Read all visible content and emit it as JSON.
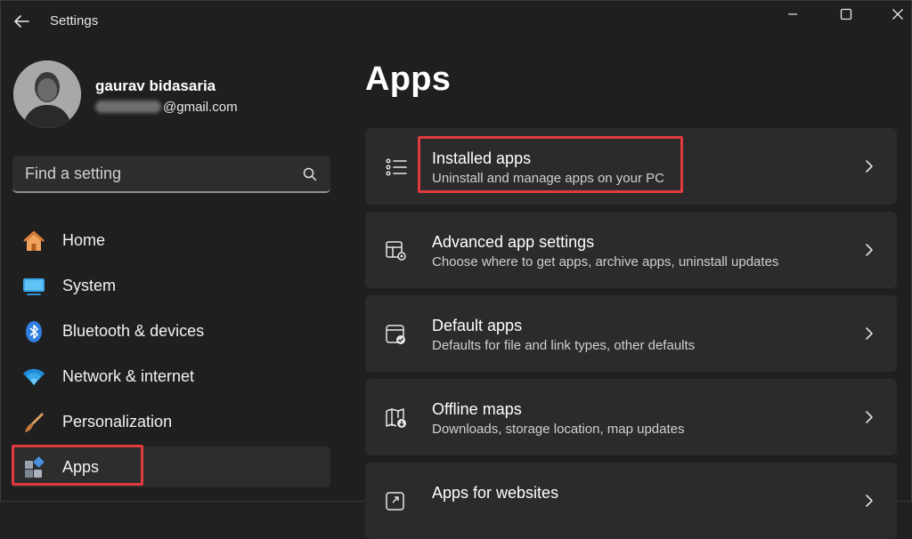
{
  "window": {
    "title": "Settings"
  },
  "profile": {
    "name": "gaurav bidasaria",
    "email_visible": "@gmail.com"
  },
  "search": {
    "placeholder": "Find a setting"
  },
  "nav": {
    "items": [
      {
        "label": "Home",
        "icon": "home-icon"
      },
      {
        "label": "System",
        "icon": "system-icon"
      },
      {
        "label": "Bluetooth & devices",
        "icon": "bluetooth-icon"
      },
      {
        "label": "Network & internet",
        "icon": "wifi-icon"
      },
      {
        "label": "Personalization",
        "icon": "brush-icon"
      },
      {
        "label": "Apps",
        "icon": "apps-icon",
        "selected": true
      }
    ]
  },
  "main": {
    "title": "Apps",
    "cards": [
      {
        "title": "Installed apps",
        "desc": "Uninstall and manage apps on your PC",
        "icon": "list-icon"
      },
      {
        "title": "Advanced app settings",
        "desc": "Choose where to get apps, archive apps, uninstall updates",
        "icon": "app-gear-icon"
      },
      {
        "title": "Default apps",
        "desc": "Defaults for file and link types, other defaults",
        "icon": "default-apps-icon"
      },
      {
        "title": "Offline maps",
        "desc": "Downloads, storage location, map updates",
        "icon": "map-icon"
      },
      {
        "title": "Apps for websites",
        "desc": "",
        "icon": "link-window-icon"
      }
    ]
  },
  "colors": {
    "accent": "#4cc2ff",
    "highlight": "#e0393e",
    "background": "#1f1f1f",
    "card": "#2b2b2b"
  }
}
